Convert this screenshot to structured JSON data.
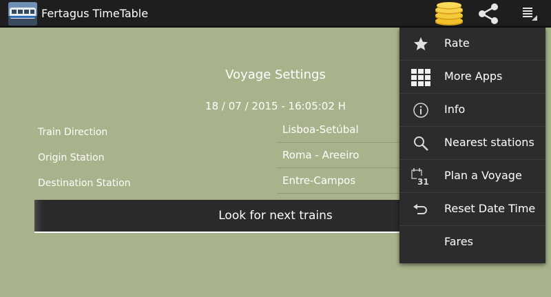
{
  "app": {
    "title": "Fertagus TimeTable"
  },
  "form": {
    "title": "Voyage Settings",
    "datetime": "18 / 07 / 2015 -  16:05:02 H",
    "rows": [
      {
        "label": "Train Direction",
        "value": "Lisboa-Setúbal"
      },
      {
        "label": "Origin Station",
        "value": "Roma - Areeiro"
      },
      {
        "label": "Destination Station",
        "value": "Entre-Campos"
      }
    ],
    "action_label": "Look for next trains"
  },
  "menu": {
    "items": [
      {
        "label": "Rate",
        "icon": "star-icon"
      },
      {
        "label": "More Apps",
        "icon": "grid-icon"
      },
      {
        "label": "Info",
        "icon": "info-icon"
      },
      {
        "label": "Nearest stations",
        "icon": "search-icon"
      },
      {
        "label": "Plan a Voyage",
        "icon": "calendar-icon",
        "icon_text": "31"
      },
      {
        "label": "Reset Date Time",
        "icon": "undo-icon"
      },
      {
        "label": "Fares",
        "icon": ""
      }
    ]
  },
  "colors": {
    "background": "#a7b48b",
    "actionbar": "#1e1e1e",
    "menu": "#2c2c2c",
    "button": "#2b2b2b",
    "coins": "#f2c12e"
  }
}
